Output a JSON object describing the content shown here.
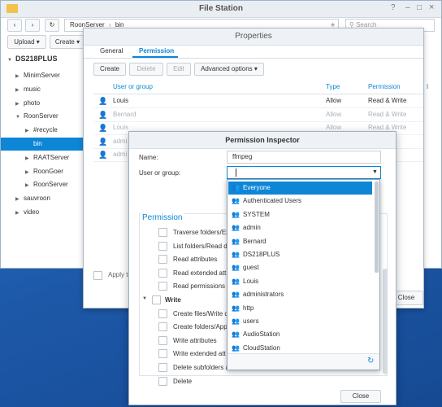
{
  "filestation": {
    "title": "File Station",
    "path": [
      "RoonServer",
      "bin"
    ],
    "upload_label": "Upload",
    "create_label": "Create",
    "search_placeholder": "Search",
    "root": "DS218PLUS",
    "tree": [
      {
        "label": "MinimServer",
        "level": 1,
        "expand": "closed"
      },
      {
        "label": "music",
        "level": 1,
        "expand": "closed"
      },
      {
        "label": "photo",
        "level": 1,
        "expand": "closed"
      },
      {
        "label": "RoonServer",
        "level": 1,
        "expand": "open"
      },
      {
        "label": "#recycle",
        "level": 2,
        "expand": "closed"
      },
      {
        "label": "bin",
        "level": 2,
        "expand": "none",
        "selected": true
      },
      {
        "label": "RAATServer",
        "level": 2,
        "expand": "closed"
      },
      {
        "label": "RoonGoer",
        "level": 2,
        "expand": "closed"
      },
      {
        "label": "RoonServer",
        "level": 2,
        "expand": "closed"
      },
      {
        "label": "sauvroon",
        "level": 1,
        "expand": "closed"
      },
      {
        "label": "video",
        "level": 1,
        "expand": "closed"
      }
    ]
  },
  "properties": {
    "title": "Properties",
    "tabs": [
      "General",
      "Permission"
    ],
    "active_tab": "Permission",
    "toolbar": {
      "create": "Create",
      "delete": "Delete",
      "edit": "Edit",
      "advanced": "Advanced options"
    },
    "columns": {
      "user": "User or group",
      "type": "Type",
      "permission": "Permission",
      "extra": "I"
    },
    "rows": [
      {
        "user": "Louis",
        "type": "Allow",
        "permission": "Read & Write",
        "dim": false
      },
      {
        "user": "Bernard",
        "type": "Allow",
        "permission": "Read & Write",
        "dim": true
      },
      {
        "user": "Louis",
        "type": "Allow",
        "permission": "Read & Write",
        "dim": true
      },
      {
        "user": "admi",
        "type": "",
        "permission": "",
        "dim": true
      },
      {
        "user": "admi",
        "type": "",
        "permission": "",
        "dim": true
      }
    ],
    "apply_label": "Apply t",
    "close_label": "Close"
  },
  "inspector": {
    "title": "Permission Inspector",
    "name_label": "Name:",
    "name_value": "ffmpeg",
    "user_label": "User or group:",
    "user_value": "",
    "section_title": "Permission",
    "perms": [
      {
        "label": "Traverse folders/Ex",
        "group": false
      },
      {
        "label": "List folders/Read d",
        "group": false
      },
      {
        "label": "Read attributes",
        "group": false
      },
      {
        "label": "Read extended att",
        "group": false
      },
      {
        "label": "Read permissions",
        "group": false
      },
      {
        "label": "Write",
        "group": true
      },
      {
        "label": "Create files/Write d",
        "group": false
      },
      {
        "label": "Create folders/App",
        "group": false
      },
      {
        "label": "Write attributes",
        "group": false
      },
      {
        "label": "Write extended att",
        "group": false
      },
      {
        "label": "Delete subfolders a",
        "group": false
      },
      {
        "label": "Delete",
        "group": false
      }
    ],
    "close_label": "Close"
  },
  "dropdown": {
    "items": [
      "Everyone",
      "Authenticated Users",
      "SYSTEM",
      "admin",
      "Bernard",
      "DS218PLUS",
      "guest",
      "Louis",
      "administrators",
      "http",
      "users",
      "AudioStation",
      "CloudStation"
    ],
    "selected": "Everyone"
  },
  "colors": {
    "accent": "#0d86d6",
    "desktop": "#1f5fb0"
  }
}
